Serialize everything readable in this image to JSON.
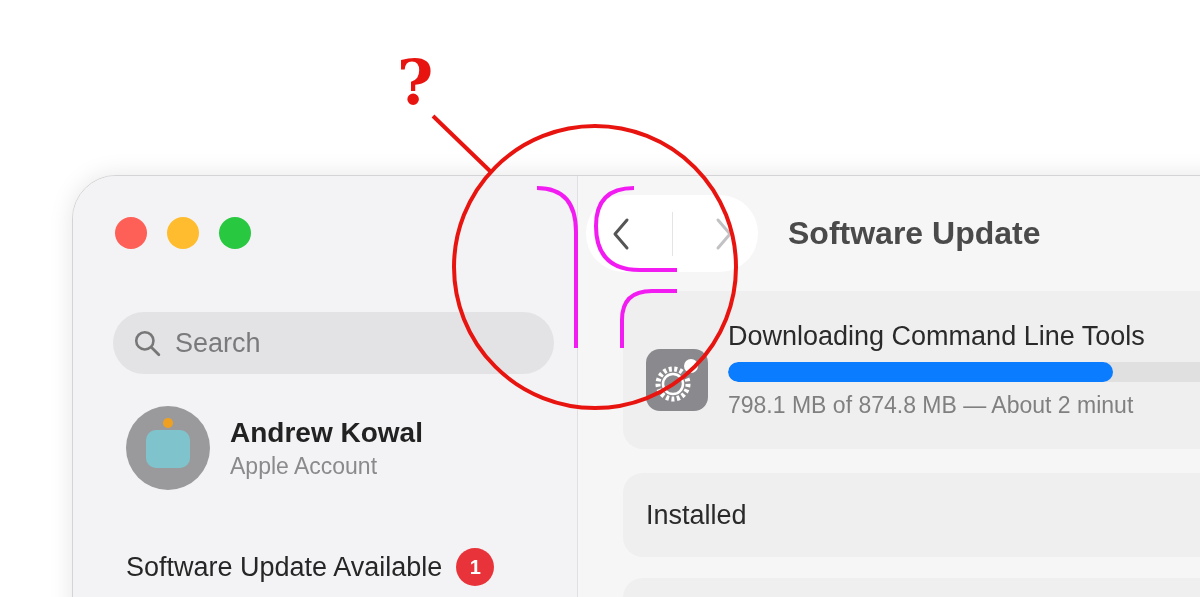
{
  "annotation": {
    "mark": "?"
  },
  "sidebar": {
    "search": {
      "placeholder": "Search"
    },
    "account": {
      "name": "Andrew Kowal",
      "subtitle": "Apple Account"
    },
    "update_notice": {
      "label": "Software Update Available",
      "badge": "1"
    }
  },
  "toolbar": {
    "title": "Software Update",
    "back": {
      "disabled": false
    },
    "forward": {
      "disabled": true
    }
  },
  "update": {
    "title": "Downloading Command Line Tools",
    "level": 0.77,
    "detail": "798.1 MB of 874.8 MB — About 2 minut"
  },
  "sections": [
    {
      "label": "Installed"
    }
  ]
}
